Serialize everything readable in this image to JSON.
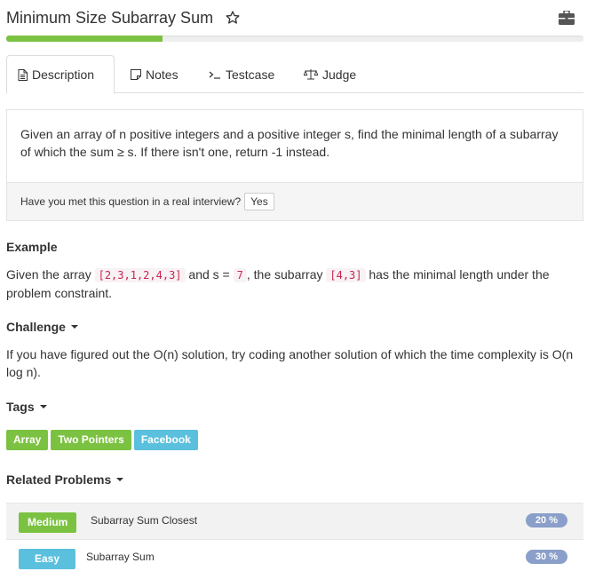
{
  "problem": {
    "title": "Minimum Size Subarray Sum",
    "progress": 0.27
  },
  "tabs": [
    {
      "label": "Description",
      "icon": "document-icon",
      "active": true
    },
    {
      "label": "Notes",
      "icon": "note-icon",
      "active": false
    },
    {
      "label": "Testcase",
      "icon": "terminal-icon",
      "active": false
    },
    {
      "label": "Judge",
      "icon": "scale-icon",
      "active": false
    }
  ],
  "description": {
    "text": "Given an array of n positive integers and a positive integer s, find the minimal length of a subarray of which the sum ≥ s. If there isn't one, return -1 instead.",
    "interview_question": "Have you met this question in a real interview?",
    "yes_label": "Yes"
  },
  "example": {
    "heading": "Example",
    "prefix": "Given the array",
    "array_code": "[2,3,1,2,4,3]",
    "middle1": "and s =",
    "s_code": "7",
    "middle2": ", the subarray",
    "sub_code": "[4,3]",
    "suffix": "has the minimal length under the problem constraint."
  },
  "challenge": {
    "heading": "Challenge",
    "text": "If you have figured out the O(n) solution, try coding another solution of which the time complexity is O(n log n)."
  },
  "tags": {
    "heading": "Tags",
    "items": [
      {
        "label": "Array",
        "color": "#7cc242"
      },
      {
        "label": "Two Pointers",
        "color": "#7cc242"
      },
      {
        "label": "Facebook",
        "color": "#5bc0de"
      }
    ]
  },
  "related": {
    "heading": "Related Problems",
    "items": [
      {
        "difficulty": "Medium",
        "difficulty_color": "#7cc242",
        "name": "Subarray Sum Closest",
        "percent": "20 %"
      },
      {
        "difficulty": "Easy",
        "difficulty_color": "#5bc0de",
        "name": "Subarray Sum",
        "percent": "30 %"
      }
    ]
  }
}
